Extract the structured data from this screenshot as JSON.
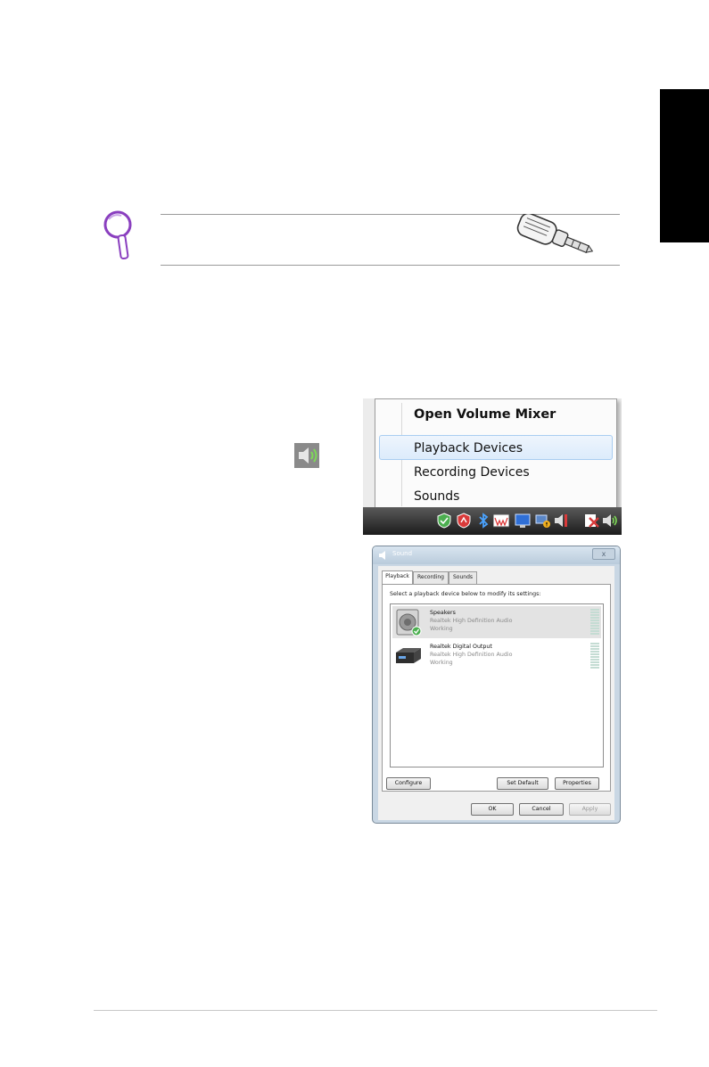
{
  "context_menu": {
    "items": [
      {
        "label": "Open Volume Mixer",
        "bold": true
      },
      {
        "label": "Playback Devices",
        "highlighted": true
      },
      {
        "label": "Recording Devices"
      },
      {
        "label": "Sounds"
      }
    ]
  },
  "sound_dialog": {
    "title": "Sound",
    "close_label": "x",
    "tabs": [
      "Playback",
      "Recording",
      "Sounds"
    ],
    "active_tab": "Playback",
    "instruction": "Select a playback device below to modify its settings:",
    "devices": [
      {
        "name": "Speakers",
        "driver": "Realtek High Definition Audio",
        "status": "Working",
        "default": true
      },
      {
        "name": "Realtek Digital Output",
        "driver": "Realtek High Definition Audio",
        "status": "Working",
        "default": false
      }
    ],
    "buttons": {
      "configure": "Configure",
      "set_default": "Set Default",
      "properties": "Properties",
      "ok": "OK",
      "cancel": "Cancel",
      "apply": "Apply"
    }
  },
  "colors": {
    "tip_icon": "#8a3fbf",
    "language_tab": "#000000",
    "highlight_border": "#a9cdf1"
  },
  "icons": [
    "magnifier-tip-icon",
    "audio-plug-adapter",
    "speaker-volume-icon"
  ]
}
